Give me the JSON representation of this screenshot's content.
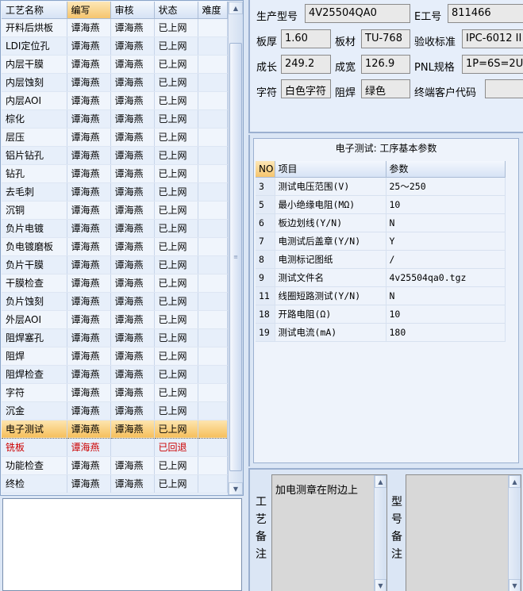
{
  "process_list": {
    "columns": [
      "工艺名称",
      "编写",
      "审核",
      "状态",
      "难度"
    ],
    "rows": [
      {
        "name": "开料后烘板",
        "writer": "谭海燕",
        "reviewer": "谭海燕",
        "status": "已上网",
        "difficulty": ""
      },
      {
        "name": "LDI定位孔",
        "writer": "谭海燕",
        "reviewer": "谭海燕",
        "status": "已上网",
        "difficulty": ""
      },
      {
        "name": "内层干膜",
        "writer": "谭海燕",
        "reviewer": "谭海燕",
        "status": "已上网",
        "difficulty": ""
      },
      {
        "name": "内层蚀刻",
        "writer": "谭海燕",
        "reviewer": "谭海燕",
        "status": "已上网",
        "difficulty": ""
      },
      {
        "name": "内层AOI",
        "writer": "谭海燕",
        "reviewer": "谭海燕",
        "status": "已上网",
        "difficulty": ""
      },
      {
        "name": "棕化",
        "writer": "谭海燕",
        "reviewer": "谭海燕",
        "status": "已上网",
        "difficulty": ""
      },
      {
        "name": "层压",
        "writer": "谭海燕",
        "reviewer": "谭海燕",
        "status": "已上网",
        "difficulty": ""
      },
      {
        "name": "铝片钻孔",
        "writer": "谭海燕",
        "reviewer": "谭海燕",
        "status": "已上网",
        "difficulty": ""
      },
      {
        "name": "钻孔",
        "writer": "谭海燕",
        "reviewer": "谭海燕",
        "status": "已上网",
        "difficulty": ""
      },
      {
        "name": "去毛刺",
        "writer": "谭海燕",
        "reviewer": "谭海燕",
        "status": "已上网",
        "difficulty": ""
      },
      {
        "name": "沉铜",
        "writer": "谭海燕",
        "reviewer": "谭海燕",
        "status": "已上网",
        "difficulty": ""
      },
      {
        "name": "负片电镀",
        "writer": "谭海燕",
        "reviewer": "谭海燕",
        "status": "已上网",
        "difficulty": ""
      },
      {
        "name": "负电镀磨板",
        "writer": "谭海燕",
        "reviewer": "谭海燕",
        "status": "已上网",
        "difficulty": ""
      },
      {
        "name": "负片干膜",
        "writer": "谭海燕",
        "reviewer": "谭海燕",
        "status": "已上网",
        "difficulty": ""
      },
      {
        "name": "干膜检查",
        "writer": "谭海燕",
        "reviewer": "谭海燕",
        "status": "已上网",
        "difficulty": ""
      },
      {
        "name": "负片蚀刻",
        "writer": "谭海燕",
        "reviewer": "谭海燕",
        "status": "已上网",
        "difficulty": ""
      },
      {
        "name": "外层AOI",
        "writer": "谭海燕",
        "reviewer": "谭海燕",
        "status": "已上网",
        "difficulty": ""
      },
      {
        "name": "阻焊塞孔",
        "writer": "谭海燕",
        "reviewer": "谭海燕",
        "status": "已上网",
        "difficulty": ""
      },
      {
        "name": "阻焊",
        "writer": "谭海燕",
        "reviewer": "谭海燕",
        "status": "已上网",
        "difficulty": ""
      },
      {
        "name": "阻焊检查",
        "writer": "谭海燕",
        "reviewer": "谭海燕",
        "status": "已上网",
        "difficulty": ""
      },
      {
        "name": "字符",
        "writer": "谭海燕",
        "reviewer": "谭海燕",
        "status": "已上网",
        "difficulty": ""
      },
      {
        "name": "沉金",
        "writer": "谭海燕",
        "reviewer": "谭海燕",
        "status": "已上网",
        "difficulty": ""
      },
      {
        "name": "电子测试",
        "writer": "谭海燕",
        "reviewer": "谭海燕",
        "status": "已上网",
        "difficulty": "",
        "selected": true
      },
      {
        "name": "铣板",
        "writer": "谭海燕",
        "reviewer": "",
        "status": "已回退",
        "difficulty": "",
        "returned": true
      },
      {
        "name": "功能检查",
        "writer": "谭海燕",
        "reviewer": "谭海燕",
        "status": "已上网",
        "difficulty": ""
      },
      {
        "name": "终检",
        "writer": "谭海燕",
        "reviewer": "谭海燕",
        "status": "已上网",
        "difficulty": ""
      }
    ]
  },
  "info": {
    "model_label": "生产型号",
    "model_value": "4V25504QA0",
    "e_no_label": "E工号",
    "e_no_value": "811466",
    "thickness_label": "板厚",
    "thickness_value": "1.60",
    "material_label": "板材",
    "material_value": "TU-768",
    "standard_label": "验收标准",
    "standard_value": "IPC-6012 II",
    "length_label": "成长",
    "length_value": "249.2",
    "width_label": "成宽",
    "width_value": "126.9",
    "pnl_label": "PNL规格",
    "pnl_value": "1P=6S=2U",
    "char_label": "字符",
    "char_value": "白色字符",
    "mask_label": "阻焊",
    "mask_value": "绿色",
    "customer_label": "终端客户代码",
    "customer_value": ""
  },
  "params": {
    "title": "电子测试: 工序基本参数",
    "columns": [
      "NO",
      "项目",
      "参数"
    ],
    "rows": [
      {
        "no": "3",
        "item": "测试电压范围(V)",
        "value": "25～250"
      },
      {
        "no": "5",
        "item": "最小绝缘电阻(MΩ)",
        "value": "10"
      },
      {
        "no": "6",
        "item": "板边划线(Y/N)",
        "value": "N"
      },
      {
        "no": "7",
        "item": "电测试后盖章(Y/N)",
        "value": "Y"
      },
      {
        "no": "8",
        "item": "电测标记图纸",
        "value": "/"
      },
      {
        "no": "9",
        "item": "测试文件名",
        "value": "4v25504qa0.tgz"
      },
      {
        "no": "11",
        "item": "线圈短路测试(Y/N)",
        "value": "N"
      },
      {
        "no": "18",
        "item": "开路电阻(Ω)",
        "value": "10"
      },
      {
        "no": "19",
        "item": "测试电流(mA)",
        "value": "180"
      }
    ]
  },
  "notes": {
    "process_label": "工艺备注",
    "process_text": "加电测章在附边上",
    "model_label": "型号备注",
    "model_text": ""
  },
  "icons": {
    "scroll_up": "scroll-up-arrow-icon",
    "scroll_down": "scroll-down-arrow-icon",
    "scroll_grip": "scroll-grip-icon"
  }
}
